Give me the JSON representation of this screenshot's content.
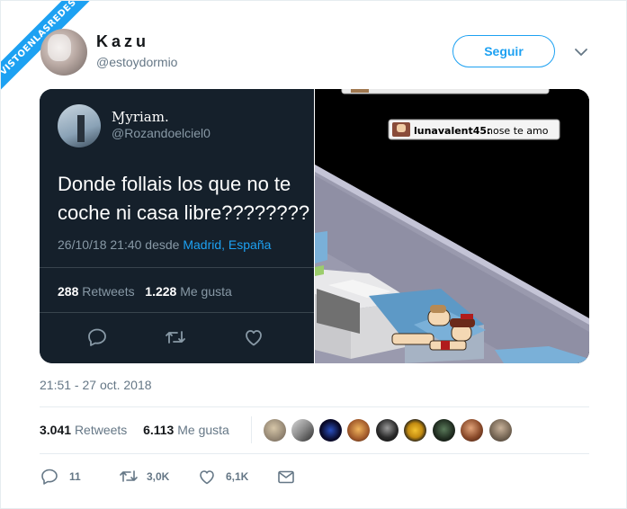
{
  "watermark": "VISTOENLASREDES",
  "author": {
    "name": "Kazu",
    "handle": "@estoydormio"
  },
  "follow_label": "Seguir",
  "media": {
    "left": {
      "name": "Ɱyriam.",
      "handle": "@Rozandoelciel0",
      "text_line1": "Donde follais los que no te",
      "text_line2": "coche ni casa libre????????",
      "date": "26/10/18 21:40 desde",
      "location": "Madrid, España",
      "retweets_count": "288",
      "retweets_label": "Retweets",
      "likes_count": "1.228",
      "likes_label": "Me gusta"
    },
    "right": {
      "chat_user": "lunavalent45:",
      "chat_text": "nose te amo"
    }
  },
  "timestamp": "21:51 - 27 oct. 2018",
  "stats": {
    "retweets_count": "3.041",
    "retweets_label": "Retweets",
    "likes_count": "6.113",
    "likes_label": "Me gusta"
  },
  "actions": {
    "replies": "11",
    "retweets": "3,0K",
    "likes": "6,1K"
  },
  "colors": {
    "accent": "#1da1f2",
    "text": "#14171a",
    "muted": "#657786",
    "dark_bg": "#15202b"
  }
}
